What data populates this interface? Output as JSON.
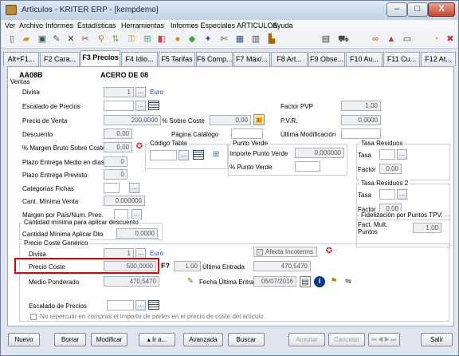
{
  "window": {
    "title": "Artículos - KRITER ERP - [kempdemo]",
    "min": "–",
    "max": "□",
    "close": "X"
  },
  "menu": [
    "Ver",
    "Archivo",
    "Informes",
    "Estadísticas",
    "Herramientas",
    "Informes Especiales ARTICULOS",
    "Ayuda"
  ],
  "tabs": [
    "Alt+F1...",
    "F2 Cara...",
    "F3 Precios",
    "F4 Idio...",
    "F5 Tarifas",
    "F6 Comp...",
    "F7 Máx/...",
    "F8 Art...",
    "F9 Obse...",
    "F10 Au...",
    "F11 Cu...",
    "F12 At..."
  ],
  "article": {
    "code": "AA08B",
    "name": "ACERO DE 08"
  },
  "ventas": {
    "section": "Ventas",
    "divisa_label": "Divisa",
    "divisa_value": "1",
    "divisa_name": "Euro",
    "escalado_label": "Escalado de Precios",
    "precio_venta_label": "Precio de Venta",
    "precio_venta_value": "200,0000",
    "sobre_coste_label": "% Sobre Coste",
    "sobre_coste_value": "0,00",
    "factor_pvp_label": "Factor PVP",
    "factor_pvp_value": "1,00",
    "pvr_label": "P.V.R.",
    "pvr_value": "0,0000",
    "descuento_label": "Descuento",
    "descuento_value": "0,00",
    "pagina_label": "Página Catálogo",
    "ultima_mod_label": "Última Modificación",
    "margen_label": "% Margen Bruto Sobre Coste",
    "margen_value": "0,00",
    "plazo_medio_label": "Plazo Entrega Medio en días",
    "plazo_medio_value": "0",
    "plazo_prev_label": "Plazo Entrega Previsto",
    "plazo_prev_value": "0",
    "categorias_label": "Categorías Fichas",
    "cant_min_label": "Cant. Mínima Venta",
    "cant_min_value": "0,000000",
    "margen_pais_label": "Margen por País/Num. Pres."
  },
  "codigo_tabla": {
    "title": "Código Tabla"
  },
  "punto_verde": {
    "title": "Punto Verde",
    "importe_label": "Importe Punto Verde",
    "importe_value": "0,000000",
    "pct_label": "% Punto Verde"
  },
  "tasa_residuos": {
    "title": "Tasa Residuos",
    "tasa_label": "Tasa",
    "factor_label": "Factor",
    "factor_value": "0,00"
  },
  "tasa_residuos2": {
    "title": "Tasa Residuos 2",
    "tasa_label": "Tasa",
    "factor_label": "Factor",
    "factor_value": "0,00"
  },
  "fidelizacion": {
    "title": "Fidelización por Puntos TPV:",
    "factor_label": "Fact. Mult. Puntos",
    "factor_value": "1,00"
  },
  "cantidad_minima": {
    "title": "Cantidad mínima para aplicar descuento",
    "label": "Cantidad Mínima Aplicar Dto",
    "value": "0,0000"
  },
  "coste": {
    "title": "Precio Coste Genérico",
    "divisa_label": "Divisa",
    "divisa_value": "1",
    "divisa_name": "Euro",
    "afecta_label": "Afecta Incoterms",
    "precio_coste_label": "Precio Coste",
    "precio_coste_value": "500,0000",
    "factor_symbol": "F?",
    "factor_value": "1,00",
    "ultima_entrada_label": "Última Entrada",
    "ultima_entrada_value": "470,5470",
    "medio_label": "Medio Ponderado",
    "medio_value": "470,5470",
    "fecha_label": "Fecha Última Entrada",
    "fecha_value": "05/07/2016",
    "escalado_label": "Escalado de Precios",
    "no_repercutir_label": "No repercutir en compras el importe de portes en el precio de coste del artículo"
  },
  "buttons": {
    "nuevo": "Nuevo",
    "borrar": "Borrar",
    "modificar": "Modificar",
    "ira": "Ir a...",
    "avanzada": "Avanzada",
    "buscar": "Buscar",
    "aceptar": "Aceptar",
    "cancelar": "Cancelar",
    "salir": "Salir"
  },
  "colors": {
    "highlight": "#e00000",
    "link": "#1a3fc7"
  }
}
